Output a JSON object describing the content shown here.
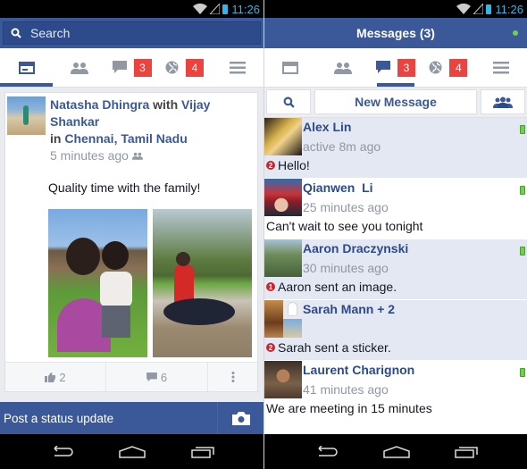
{
  "status_bar": {
    "time": "11:26"
  },
  "left": {
    "search": {
      "placeholder": "Search"
    },
    "tabs": [
      {
        "name": "news-feed",
        "icon": "news-feed-icon",
        "active": true
      },
      {
        "name": "friends",
        "icon": "friends-icon"
      },
      {
        "name": "messages",
        "icon": "chat-icon",
        "badge": "3"
      },
      {
        "name": "notifications",
        "icon": "globe-icon",
        "badge": "4"
      },
      {
        "name": "menu",
        "icon": "menu-icon"
      }
    ],
    "post": {
      "author": "Natasha Dhingra",
      "with_word": "with",
      "tagged": "Vijay Shankar",
      "in_word": "in",
      "location": "Chennai, Tamil Nadu",
      "time": "5 minutes ago",
      "audience_icon": "friends-icon",
      "text": "Quality time with the family!",
      "likes": "2",
      "comments": "6"
    },
    "post_bar": {
      "label": "Post a status update"
    }
  },
  "right": {
    "title": "Messages (3)",
    "tabs": [
      {
        "name": "news-feed",
        "icon": "news-feed-icon"
      },
      {
        "name": "friends",
        "icon": "friends-icon"
      },
      {
        "name": "messages",
        "icon": "chat-icon",
        "badge": "3",
        "active": true
      },
      {
        "name": "notifications",
        "icon": "globe-icon",
        "badge": "4"
      },
      {
        "name": "menu",
        "icon": "menu-icon"
      }
    ],
    "new_message_label": "New Message",
    "threads": [
      {
        "name": "Alex Lin",
        "time": "active 8m ago",
        "message": "Hello!",
        "unread_count": "2",
        "unread": true,
        "mobile": true
      },
      {
        "name": "Qianwen  Li",
        "time": "25 minutes ago",
        "message": "Can't wait to see you tonight",
        "unread": false,
        "mobile": true
      },
      {
        "name": "Aaron Draczynski",
        "time": "30 minutes ago",
        "message": "Aaron sent an image.",
        "unread_count": "1",
        "unread": true,
        "mobile": true
      },
      {
        "name": "Sarah Mann + 2",
        "time": "",
        "message": "Sarah sent a sticker.",
        "unread_count": "2",
        "unread": true,
        "mobile": false
      },
      {
        "name": "Laurent Charignon",
        "time": "41 minutes ago",
        "message": "We are meeting in 15 minutes",
        "unread": false,
        "mobile": true
      }
    ]
  },
  "colors": {
    "brand": "#3b5998",
    "badge": "#e9443f",
    "online": "#6fd04a"
  }
}
